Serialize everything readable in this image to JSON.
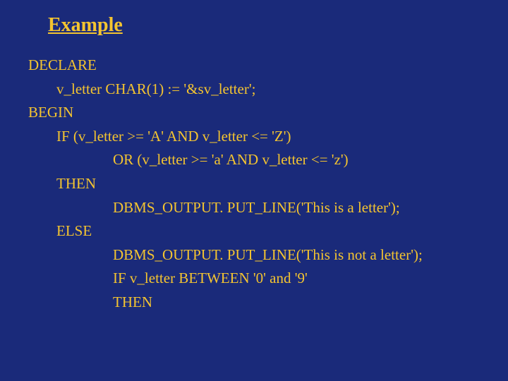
{
  "title": "Example",
  "code": {
    "l1": "DECLARE",
    "l2": "v_letter CHAR(1) := '&sv_letter';",
    "l3": "BEGIN",
    "l4": "IF (v_letter >= 'A' AND v_letter <= 'Z')",
    "l5": "OR (v_letter >= 'a' AND v_letter <= 'z')",
    "l6": "THEN",
    "l7": "DBMS_OUTPUT. PUT_LINE('This is a letter');",
    "l8": "ELSE",
    "l9": "DBMS_OUTPUT. PUT_LINE('This is not a letter');",
    "l10": "IF v_letter BETWEEN '0' and '9'",
    "l11": "THEN"
  }
}
